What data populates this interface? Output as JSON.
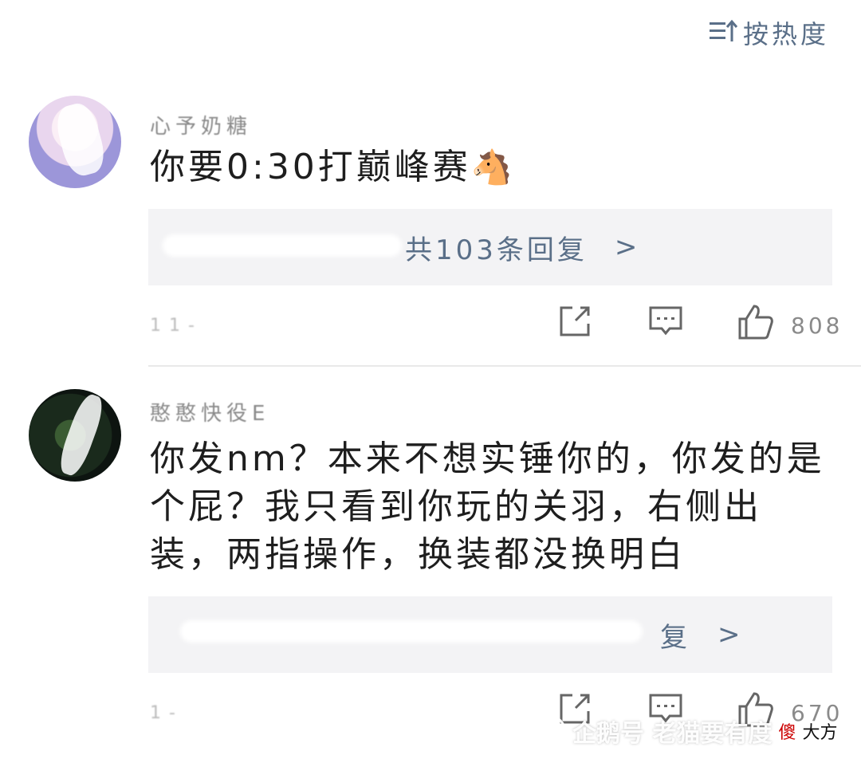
{
  "sort": {
    "label": "按热度",
    "icon": "sort-icon"
  },
  "comments": [
    {
      "username": "心予奶糖",
      "text": "你要0:30打巅峰赛",
      "emoji": "🐴",
      "reply": {
        "text": "共103条回复",
        "chevron": ">"
      },
      "time": "11-",
      "likes": "808"
    },
    {
      "username": "憨憨快役E",
      "text": "你发nm？本来不想实锤你的，你发的是个屁？我只看到你玩的关羽，右侧出装，两指操作，换装都没换明白",
      "reply": {
        "text": "复",
        "chevron": ">"
      },
      "time": "1-",
      "likes": "670"
    }
  ],
  "watermark": {
    "text": "企鹅号 老猫要有度",
    "suffix_red": "傻",
    "suffix_black": "大方"
  }
}
